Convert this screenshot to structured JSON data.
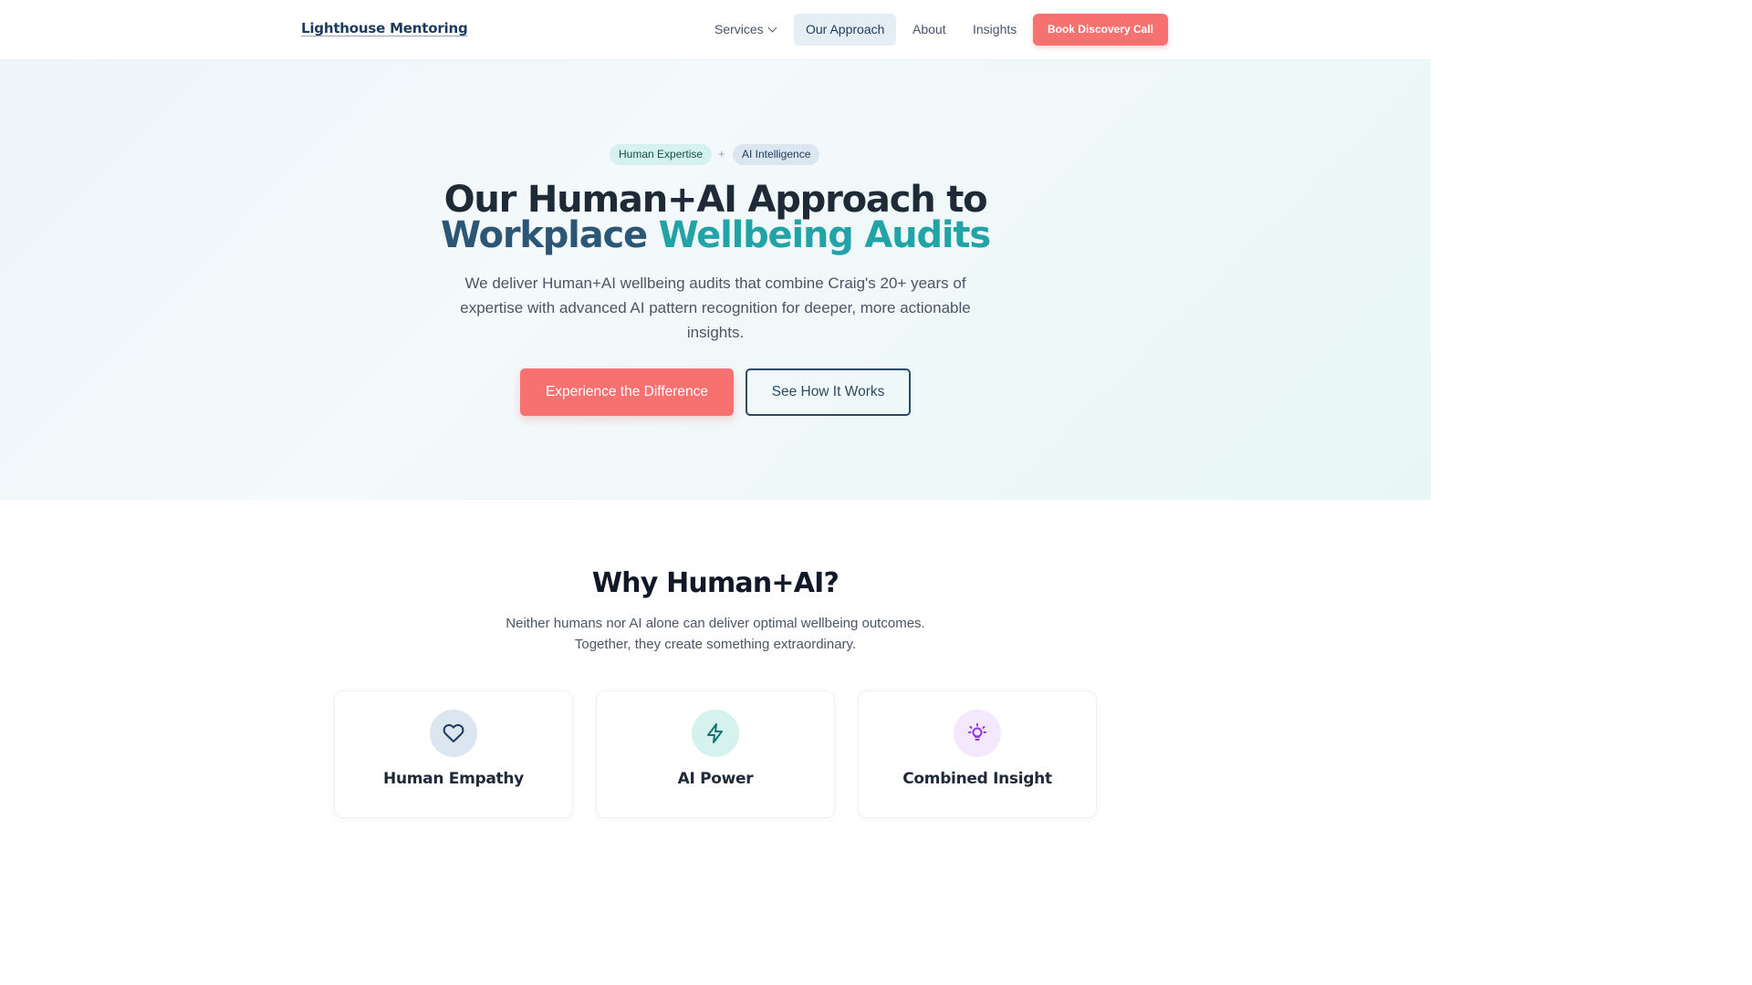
{
  "nav": {
    "logo": "Lighthouse Mentoring",
    "items": [
      {
        "label": "Services"
      },
      {
        "label": "Our Approach"
      },
      {
        "label": "About"
      },
      {
        "label": "Insights"
      }
    ],
    "cta": "Book Discovery Call"
  },
  "hero": {
    "pill_human": "Human Expertise",
    "pill_plus": "+",
    "pill_ai": "AI Intelligence",
    "title_line1": "Our Human+AI Approach to",
    "title_line2_a": "Workplace",
    "title_line2_b": "Wellbeing Audits",
    "subtitle": "We deliver Human+AI wellbeing audits that combine Craig's 20+ years of expertise with advanced AI pattern recognition for deeper, more actionable insights.",
    "primary_cta": "Experience the Difference",
    "secondary_cta": "See How It Works"
  },
  "why": {
    "title": "Why Human+AI?",
    "subtitle_line1": "Neither humans nor AI alone can deliver optimal wellbeing outcomes.",
    "subtitle_line2": "Together, they create something extraordinary.",
    "cards": [
      {
        "title": "Human Empathy",
        "icon": "heart-icon"
      },
      {
        "title": "AI Power",
        "icon": "lightning-icon"
      },
      {
        "title": "Combined Insight",
        "icon": "lightbulb-icon"
      }
    ]
  },
  "colors": {
    "accent_coral": "#f87171",
    "navy": "#2c5676",
    "teal": "#22a3a8"
  }
}
